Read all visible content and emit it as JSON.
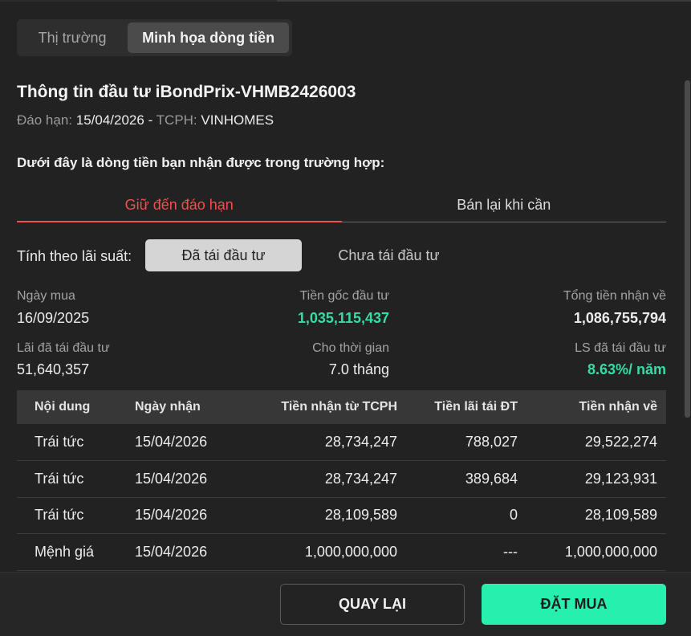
{
  "main_tabs": [
    "Thị trường",
    "Minh họa dòng tiền"
  ],
  "title": "Thông tin đầu tư iBondPrix-VHMB2426003",
  "maturity_label": "Đáo hạn:",
  "maturity_date": "15/04/2026",
  "separator": "-",
  "issuer_label": "TCPH:",
  "issuer": "VINHOMES",
  "description": "Dưới đây là dòng tiền bạn nhận được trong trường hợp:",
  "sub_tabs": [
    "Giữ đến đáo hạn",
    "Bán lại khi cần"
  ],
  "rate_label": "Tính theo lãi suất:",
  "rate_options": [
    "Đã tái đầu tư",
    "Chưa tái đầu tư"
  ],
  "info": {
    "buy_date_label": "Ngày mua",
    "buy_date": "16/09/2025",
    "principal_label": "Tiền gốc đầu tư",
    "principal": "1,035,115,437",
    "total_label": "Tổng tiền nhận về",
    "total": "1,086,755,794",
    "reinvest_interest_label": "Lãi đã tái đầu tư",
    "reinvest_interest": "51,640,357",
    "period_label": "Cho thời gian",
    "period": "7.0 tháng",
    "rate_reinvest_label": "LS đã tái đầu tư",
    "rate_reinvest": "8.63%/ năm"
  },
  "table": {
    "headers": [
      "Nội dung",
      "Ngày nhận",
      "Tiền nhận từ TCPH",
      "Tiền lãi tái ĐT",
      "Tiền nhận về"
    ],
    "rows": [
      [
        "Trái tức",
        "15/04/2026",
        "28,734,247",
        "788,027",
        "29,522,274"
      ],
      [
        "Trái tức",
        "15/04/2026",
        "28,734,247",
        "389,684",
        "29,123,931"
      ],
      [
        "Trái tức",
        "15/04/2026",
        "28,109,589",
        "0",
        "28,109,589"
      ],
      [
        "Mệnh giá",
        "15/04/2026",
        "1,000,000,000",
        "---",
        "1,000,000,000"
      ]
    ]
  },
  "buttons": {
    "back": "QUAY LẠI",
    "buy": "ĐẶT MUA"
  },
  "colors": {
    "accent_red": "#f04f4b",
    "accent_green": "#27f0ae",
    "value_green": "#38dba6"
  }
}
